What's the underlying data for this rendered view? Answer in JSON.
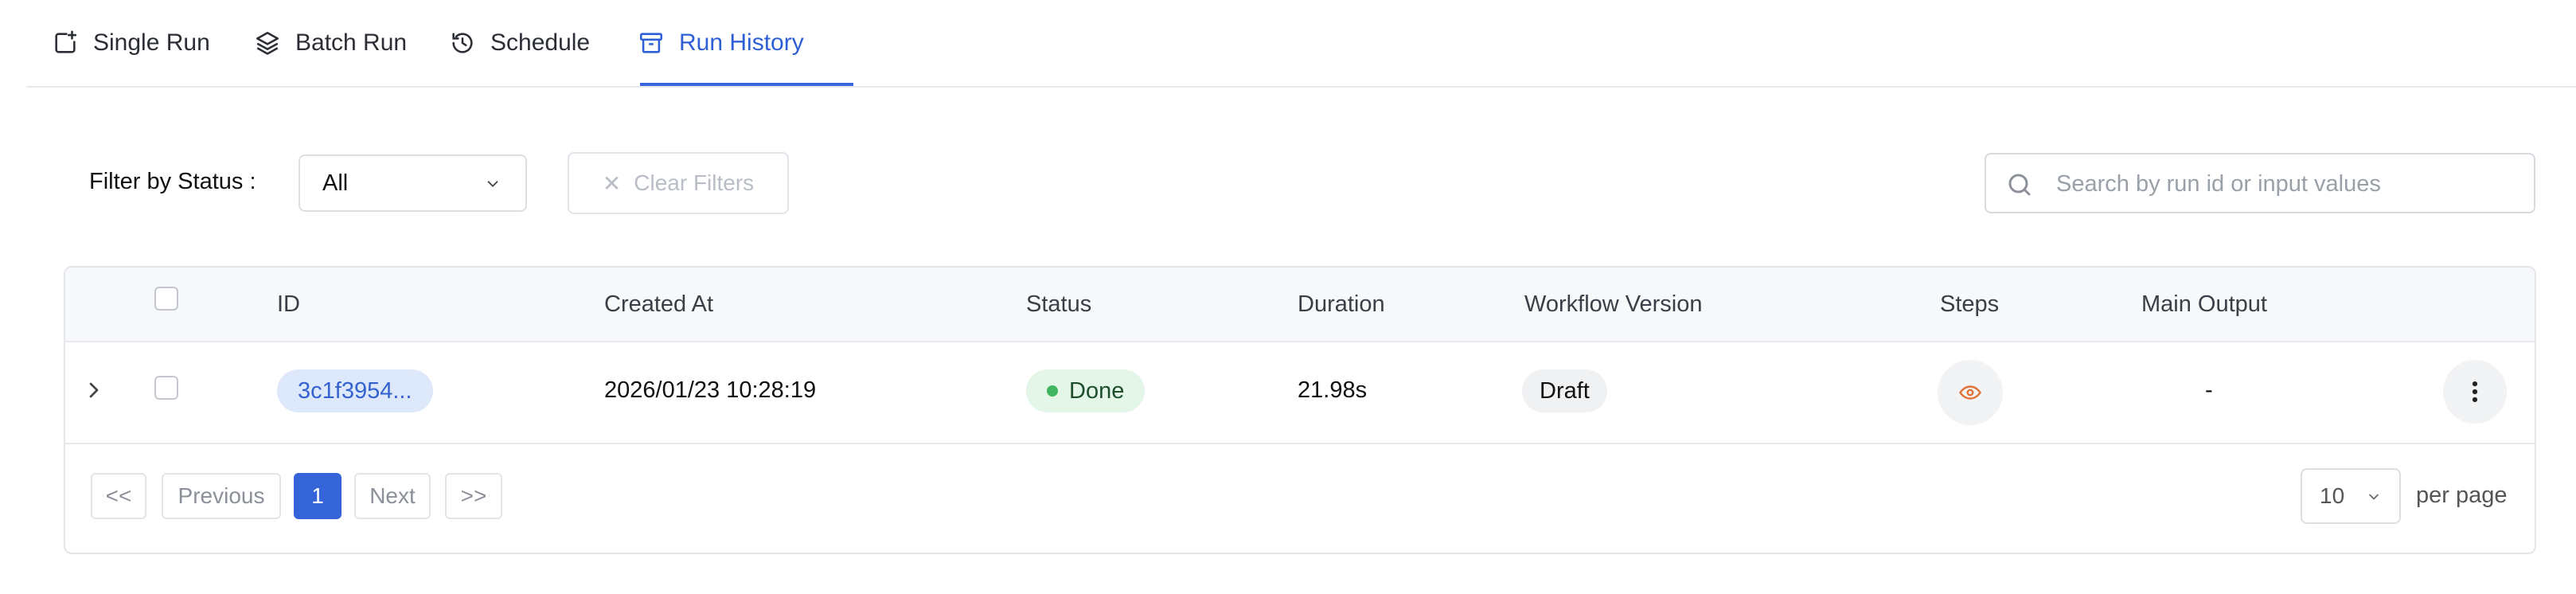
{
  "tabs": [
    {
      "label": "Single Run",
      "icon": "window-plus-icon"
    },
    {
      "label": "Batch Run",
      "icon": "layers-icon"
    },
    {
      "label": "Schedule",
      "icon": "history-clock-icon"
    },
    {
      "label": "Run History",
      "icon": "archive-box-icon",
      "active": true
    }
  ],
  "filters": {
    "status_label": "Filter by Status :",
    "status_value": "All",
    "clear_label": "Clear Filters",
    "search_placeholder": "Search by run id or input values"
  },
  "table": {
    "columns": [
      "ID",
      "Created At",
      "Status",
      "Duration",
      "Workflow Version",
      "Steps",
      "Main Output"
    ],
    "rows": [
      {
        "id": "3c1f3954...",
        "created_at": "2026/01/23 10:28:19",
        "status": "Done",
        "duration": "21.98s",
        "workflow_version": "Draft",
        "main_output": "-"
      }
    ]
  },
  "pagination": {
    "first": "<<",
    "previous": "Previous",
    "current_page": "1",
    "next": "Next",
    "last": ">>",
    "per_page_value": "10",
    "per_page_label": "per page"
  },
  "colors": {
    "accent": "#3563d8",
    "status_done_bg": "#e3f6e8",
    "status_done_dot": "#3fb560",
    "eye_icon": "#e0733a"
  }
}
